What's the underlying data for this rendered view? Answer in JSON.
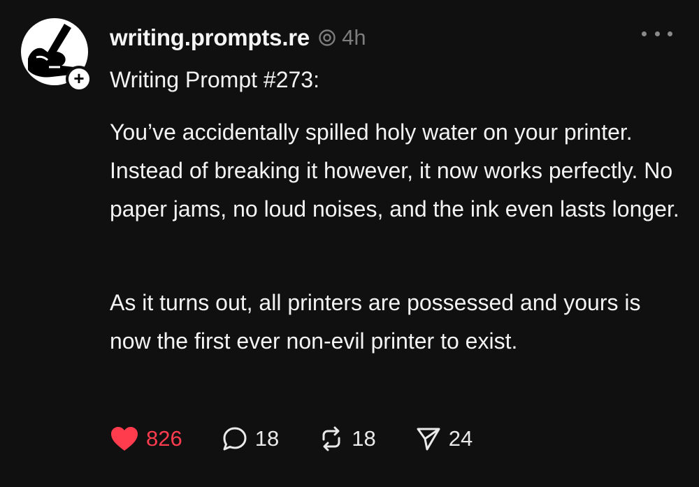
{
  "post": {
    "username": "writing.prompts.re",
    "time": "4h",
    "title": "Writing Prompt #273:",
    "paragraph1": "You’ve accidentally spilled holy water on your printer. Instead of breaking it however, it now works perfectly. No paper jams, no loud noises, and the ink even lasts longer.",
    "paragraph2": "As it turns out, all printers are possessed and yours is now the first ever non-evil printer to exist."
  },
  "actions": {
    "likes": "826",
    "replies": "18",
    "reposts": "18",
    "shares": "24"
  },
  "icons": {
    "avatar": "hand-writing-icon",
    "follow": "plus-icon",
    "repost_indicator": "threads-icon",
    "more": "more-options-icon",
    "like": "heart-icon",
    "reply": "comment-icon",
    "repost": "repost-icon",
    "share": "send-icon"
  },
  "colors": {
    "background": "#101010",
    "text": "#f3f3f3",
    "muted": "#7d7d7d",
    "like": "#ff3b4e"
  }
}
